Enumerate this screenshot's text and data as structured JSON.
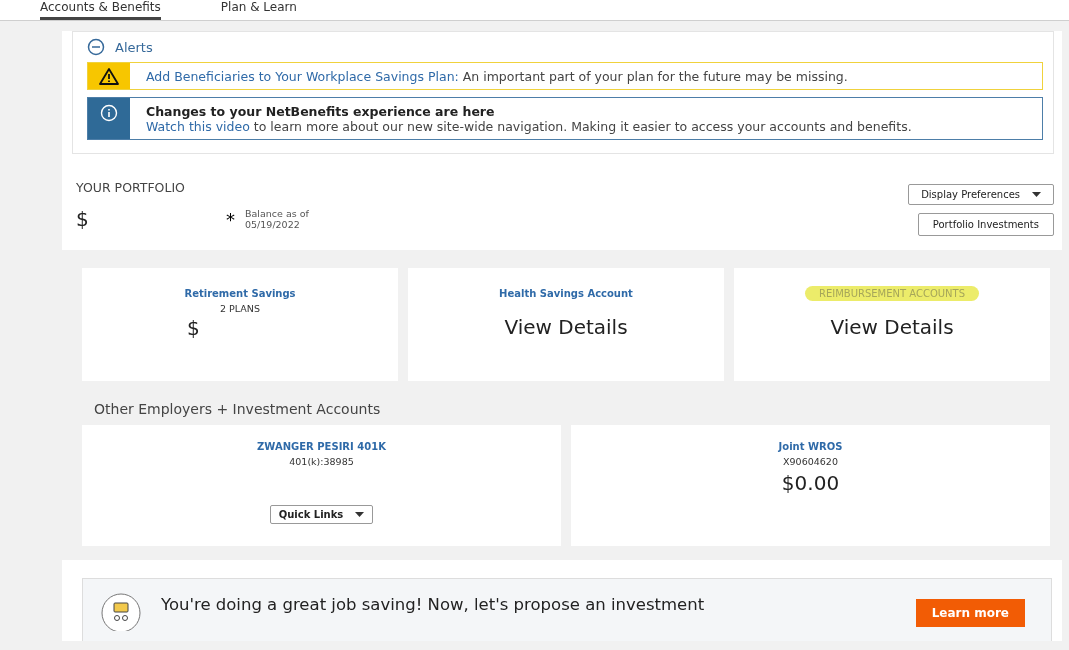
{
  "nav": {
    "tabs": [
      {
        "label": "Accounts & Benefits",
        "selected": true
      },
      {
        "label": "Plan & Learn",
        "selected": false
      }
    ]
  },
  "alerts": {
    "title": "Alerts",
    "expanded": true,
    "items": [
      {
        "kind": "warning",
        "link": "Add Beneficiaries to Your Workplace Savings Plan:",
        "text": "An important part of your plan for the future may be missing."
      },
      {
        "kind": "info",
        "heading": "Changes to your NetBenefits experience are here",
        "link": "Watch this video",
        "text": "to learn more about our new site-wide navigation. Making it easier to access your accounts and benefits."
      }
    ]
  },
  "portfolio": {
    "title": "YOUR PORTFOLIO",
    "currency": "$",
    "asterisk": "*",
    "balance_label": "Balance as of",
    "balance_date": "05/19/2022",
    "buttons": [
      {
        "label": "Display Preferences",
        "dropdown": true
      },
      {
        "label": "Portfolio Investments",
        "dropdown": false
      }
    ]
  },
  "account_cards": [
    {
      "title": "Retirement Savings",
      "subtitle": "2 PLANS",
      "value": "$",
      "kind": "amount",
      "highlighted": false
    },
    {
      "title": "Health Savings Account",
      "value": "View Details",
      "kind": "details",
      "highlighted": false
    },
    {
      "title": "REIMBURSEMENT ACCOUNTS",
      "value": "View Details",
      "kind": "details",
      "highlighted": true
    }
  ],
  "other_accounts": {
    "title": "Other Employers + Investment Accounts",
    "cards": [
      {
        "title": "ZWANGER PESIRI 401K",
        "number": "401(k):38985",
        "action": "Quick Links"
      },
      {
        "title": "Joint WROS",
        "number": "X90604620",
        "value": "$0.00"
      }
    ]
  },
  "banner": {
    "text": "You're doing a great job saving! Now, let's propose an investment",
    "button": "Learn more"
  }
}
